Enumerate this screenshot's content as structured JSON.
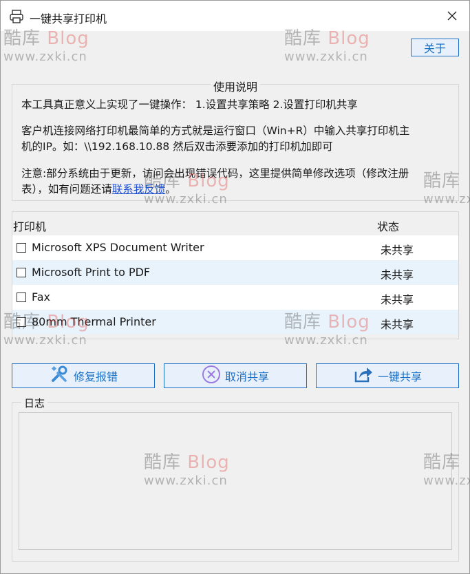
{
  "window": {
    "title": "一键共享打印机",
    "about_label": "关于"
  },
  "instructions": {
    "legend": "使用说明",
    "line1": "本工具真正意义上实现了一键操作： 1.设置共享策略 2.设置打印机共享",
    "line2a": "客户机连接网络打印机最简单的方式就是运行窗口（Win+R）中输入共享打印机主",
    "line2b": "机的IP。如：\\\\192.168.10.88 然后双击添要添加的打印机加即可",
    "line3a": "注意:部分系统由于更新，访问会出现错误代码，这里提供简单修改选项（修改注册",
    "line3b_prefix": "表），如有问题还请",
    "line3b_link": "联系我反馈",
    "line3b_suffix": "。"
  },
  "printers": {
    "col_name": "打印机",
    "col_status": "状态",
    "rows": [
      {
        "name": "Microsoft XPS Document Writer",
        "status": "未共享"
      },
      {
        "name": "Microsoft Print to PDF",
        "status": "未共享"
      },
      {
        "name": "Fax",
        "status": "未共享"
      },
      {
        "name": "80mm Thermal Printer",
        "status": "未共享"
      }
    ]
  },
  "actions": {
    "repair_label": "修复报错",
    "cancel_share_label": "取消共享",
    "one_click_share_label": "一键共享"
  },
  "log": {
    "legend": "日志"
  },
  "watermark": {
    "brand_prefix": "酷库",
    "brand_suffix": "Blog",
    "url": "www.zxki.cn"
  },
  "colors": {
    "accent": "#1b6fc4",
    "link": "#1b4fd6",
    "row_alt": "#e9f3fb",
    "panel_bg": "#f0f0f0"
  }
}
